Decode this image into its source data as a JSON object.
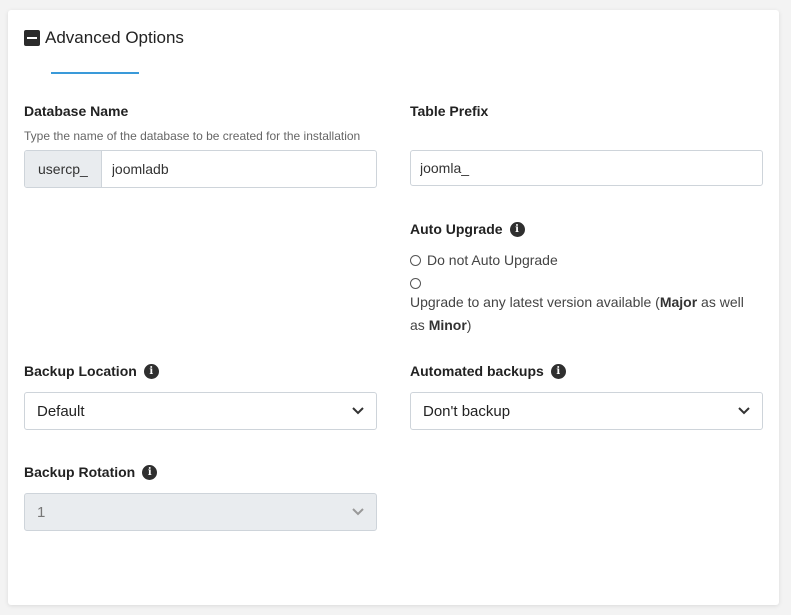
{
  "section": {
    "title": "Advanced Options"
  },
  "database": {
    "label": "Database Name",
    "hint": "Type the name of the database to be created for the installation",
    "prefix": "usercp_",
    "value": "joomladb"
  },
  "table_prefix": {
    "label": "Table Prefix",
    "value": "joomla_"
  },
  "auto_upgrade": {
    "label": "Auto Upgrade",
    "option1": "Do not Auto Upgrade",
    "option2_part1": "Upgrade to any latest version available (",
    "option2_major": "Major",
    "option2_part2": " as well as ",
    "option2_minor": "Minor",
    "option2_part3": ")"
  },
  "backup_location": {
    "label": "Backup Location",
    "selected": "Default"
  },
  "automated_backups": {
    "label": "Automated backups",
    "selected": "Don't backup"
  },
  "backup_rotation": {
    "label": "Backup Rotation",
    "selected": "1"
  },
  "icons": {
    "info": "i"
  }
}
